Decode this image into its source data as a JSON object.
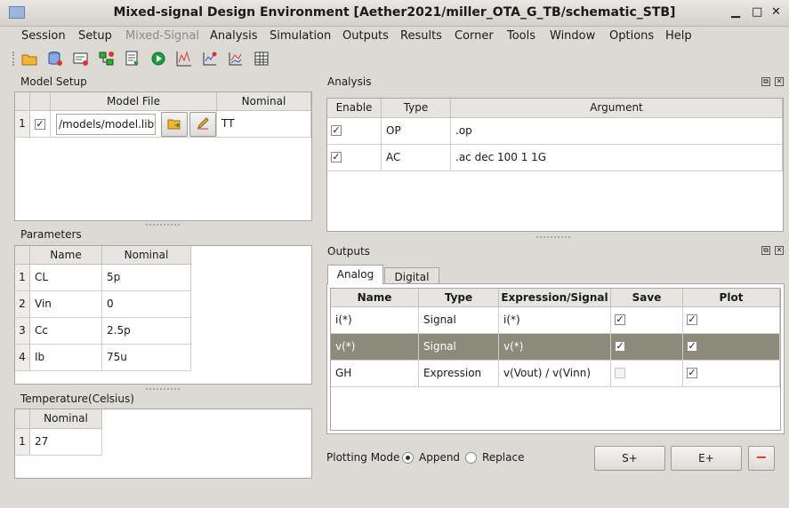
{
  "window": {
    "title": "Mixed-signal Design Environment [Aether2021/miller_OTA_G_TB/schematic_STB]",
    "min": "▁",
    "max": "□",
    "close": "✕"
  },
  "menu": [
    "Session",
    "Setup",
    "Mixed-Signal",
    "Analysis",
    "Simulation",
    "Outputs",
    "Results",
    "Corner",
    "Tools",
    "Window",
    "Options",
    "Help"
  ],
  "toolbar": [
    "open-folder-icon",
    "database-icon",
    "netlist-icon",
    "network-icon",
    "run-script-icon",
    "run-icon",
    "waveform-icon",
    "results-icon",
    "compare-icon",
    "table-icon"
  ],
  "model_setup": {
    "title": "Model Setup",
    "headers": [
      "Model File",
      "Nominal"
    ],
    "rows": [
      {
        "n": "1",
        "checked": true,
        "file": "/models/model.lib",
        "nominal": "TT"
      }
    ]
  },
  "parameters": {
    "title": "Parameters",
    "headers": [
      "Name",
      "Nominal"
    ],
    "rows": [
      {
        "n": "1",
        "name": "CL",
        "value": "5p"
      },
      {
        "n": "2",
        "name": "Vin",
        "value": "0"
      },
      {
        "n": "3",
        "name": "Cc",
        "value": "2.5p"
      },
      {
        "n": "4",
        "name": "Ib",
        "value": "75u"
      }
    ]
  },
  "temperature": {
    "title": "Temperature(Celsius)",
    "headers": [
      "Nominal"
    ],
    "rows": [
      {
        "n": "1",
        "value": "27"
      }
    ]
  },
  "analysis": {
    "title": "Analysis",
    "headers": [
      "Enable",
      "Type",
      "Argument"
    ],
    "rows": [
      {
        "enabled": true,
        "type": "OP",
        "arg": ".op"
      },
      {
        "enabled": true,
        "type": "AC",
        "arg": ".ac dec 100 1 1G"
      }
    ]
  },
  "outputs": {
    "title": "Outputs",
    "tabs": [
      "Analog",
      "Digital"
    ],
    "headers": [
      "Name",
      "Type",
      "Expression/Signal",
      "Save",
      "Plot"
    ],
    "rows": [
      {
        "name": "i(*)",
        "type": "Signal",
        "expr": "i(*)",
        "save": true,
        "plot": true
      },
      {
        "name": "v(*)",
        "type": "Signal",
        "expr": "v(*)",
        "save": true,
        "plot": true
      },
      {
        "name": "GH",
        "type": "Expression",
        "expr": "v(Vout) / v(Vinn)",
        "save": false,
        "plot": true
      }
    ],
    "plotting_mode_label": "Plotting Mode",
    "append": "Append",
    "replace": "Replace",
    "mode": "Append",
    "buttons": {
      "s_plus": "S+",
      "e_plus": "E+",
      "remove": "−"
    }
  },
  "colors": {
    "selected_row": "#8c8a7b",
    "remove_icon": "#d9381e"
  }
}
